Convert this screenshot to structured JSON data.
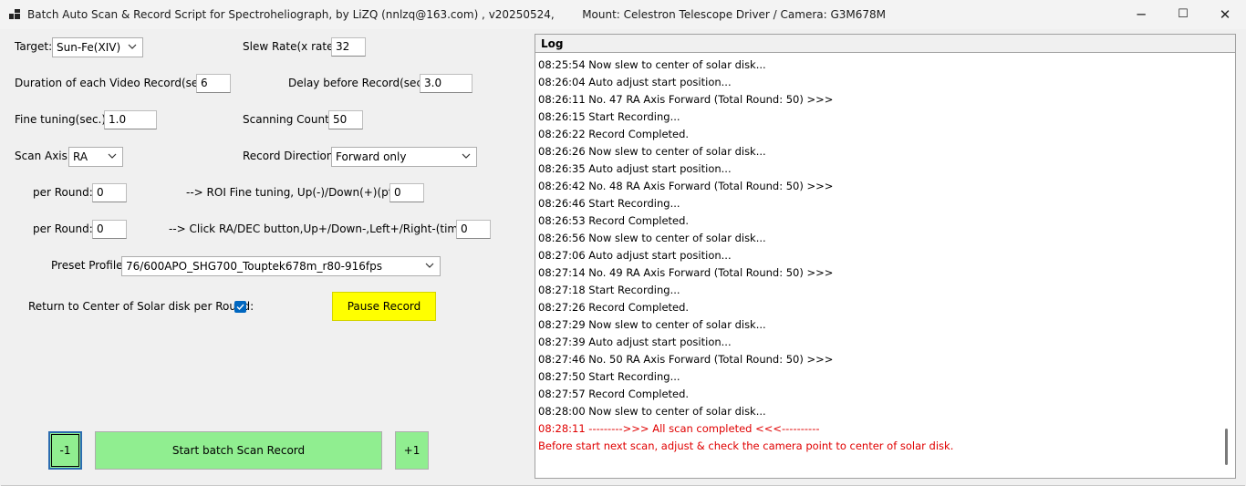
{
  "window": {
    "title": "Batch Auto Scan & Record Script for Spectroheliograph, by LiZQ (nnlzq@163.com) , v20250524,        Mount: Celestron Telescope Driver / Camera: G3M678M",
    "controls": {
      "minimize": "─",
      "maximize": "☐",
      "close": "✕"
    }
  },
  "form": {
    "target_label": "Target:",
    "target_value": "Sun-Fe(XIV)",
    "slew_rate_label": "Slew Rate(x rate):",
    "slew_rate_value": "32",
    "duration_label": "Duration of each Video Record(sec.):",
    "duration_value": "6",
    "delay_label": "Delay before Record(sec.):",
    "delay_value": "3.0",
    "fine_tuning_label": "Fine tuning(sec.):",
    "fine_tuning_value": "1.0",
    "scanning_count_label": "Scanning Count:",
    "scanning_count_value": "50",
    "scan_axis_label": "Scan Axis:",
    "scan_axis_value": "RA",
    "record_direction_label": "Record Direction:",
    "record_direction_value": "Forward only",
    "per_round_label_1": "per Round:",
    "per_round_value_1": "0",
    "roi_label": "-->  ROI Fine tuning, Up(-)/Down(+)(pt):",
    "roi_value": "0",
    "per_round_label_2": "per Round:",
    "per_round_value_2": "0",
    "click_label": "-->  Click RA/DEC button,Up+/Down-,Left+/Right-(times):",
    "click_value": "0",
    "preset_label": "Preset Profile:",
    "preset_value": "76/600APO_SHG700_Touptek678m_r80-916fps",
    "return_center_label": "Return to Center of Solar disk per Round:",
    "return_center_checked": true,
    "pause_button": "Pause Record",
    "minus_button": "-1",
    "start_button": "Start batch Scan  Record",
    "plus_button": "+1"
  },
  "log": {
    "header": "Log",
    "lines": [
      {
        "text": "08:25:54 Now slew to center of solar disk...",
        "color": "#000000"
      },
      {
        "text": "08:26:04 Auto adjust start position...",
        "color": "#000000"
      },
      {
        "text": "08:26:11 No. 47  RA Axis Forward (Total Round: 50) >>>",
        "color": "#000000"
      },
      {
        "text": "08:26:15 Start Recording...",
        "color": "#000000"
      },
      {
        "text": "08:26:22 Record Completed.",
        "color": "#000000"
      },
      {
        "text": "08:26:26 Now slew to center of solar disk...",
        "color": "#000000"
      },
      {
        "text": "08:26:35 Auto adjust start position...",
        "color": "#000000"
      },
      {
        "text": "08:26:42 No. 48  RA Axis Forward (Total Round: 50) >>>",
        "color": "#000000"
      },
      {
        "text": "08:26:46 Start Recording...",
        "color": "#000000"
      },
      {
        "text": "08:26:53 Record Completed.",
        "color": "#000000"
      },
      {
        "text": "08:26:56 Now slew to center of solar disk...",
        "color": "#000000"
      },
      {
        "text": "08:27:06 Auto adjust start position...",
        "color": "#000000"
      },
      {
        "text": "08:27:14 No. 49  RA Axis Forward (Total Round: 50) >>>",
        "color": "#000000"
      },
      {
        "text": "08:27:18 Start Recording...",
        "color": "#000000"
      },
      {
        "text": "08:27:26 Record Completed.",
        "color": "#000000"
      },
      {
        "text": "08:27:29 Now slew to center of solar disk...",
        "color": "#000000"
      },
      {
        "text": "08:27:39 Auto adjust start position...",
        "color": "#000000"
      },
      {
        "text": "08:27:46 No. 50  RA Axis Forward (Total Round: 50) >>>",
        "color": "#000000"
      },
      {
        "text": "08:27:50 Start Recording...",
        "color": "#000000"
      },
      {
        "text": "08:27:57 Record Completed.",
        "color": "#000000"
      },
      {
        "text": "08:28:00 Now slew to center of solar disk...",
        "color": "#000000"
      },
      {
        "text": "08:28:11 --------->>> All scan completed <<<----------",
        "color": "#e00000"
      },
      {
        "text": "Before start next scan, adjust & check the camera point to center of solar disk.",
        "color": "#e00000"
      }
    ]
  },
  "icons": {
    "app": "app-icon",
    "dropdown": "chevron-down-icon",
    "checkbox": "check-icon"
  },
  "colors": {
    "pause_button": "#ffff00",
    "green_buttons": "#90ee90",
    "checkbox": "#0067c0",
    "error_text": "#e00000"
  }
}
